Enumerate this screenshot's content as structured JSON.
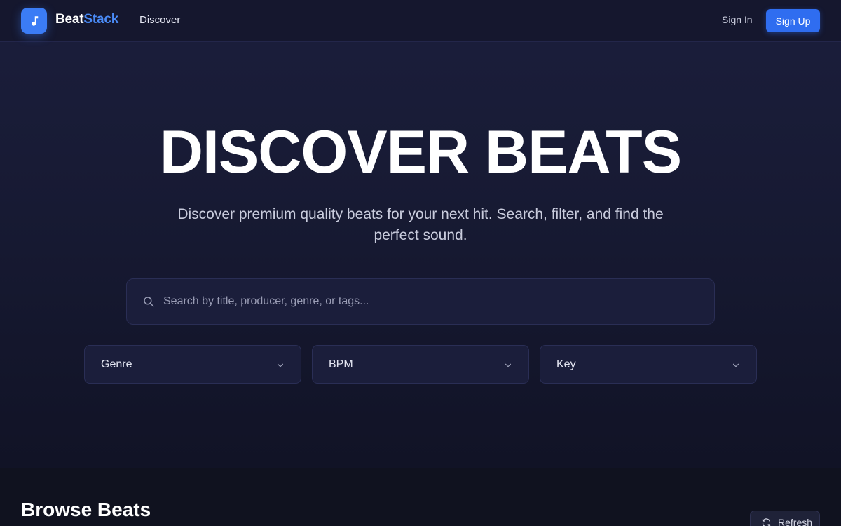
{
  "nav": {
    "brand_part1": "Beat",
    "brand_part2": "Stack",
    "logo_icon": "music-note-icon",
    "discover_label": "Discover",
    "signin_label": "Sign In",
    "signup_label": "Sign Up"
  },
  "hero": {
    "title": "DISCOVER BEATS",
    "subtitle": "Discover premium quality beats for your next hit. Search, filter, and find the perfect sound."
  },
  "search": {
    "placeholder": "Search by title, producer, genre, or tags...",
    "value": "",
    "icon": "search-icon"
  },
  "filters": [
    {
      "label": "Genre",
      "icon": "chevron-down-icon"
    },
    {
      "label": "BPM",
      "icon": "chevron-down-icon"
    },
    {
      "label": "Key",
      "icon": "chevron-down-icon"
    }
  ],
  "browse": {
    "title": "Browse Beats",
    "refresh_label": "Refresh",
    "refresh_icon": "refresh-icon"
  },
  "colors": {
    "accent": "#3b7cf5",
    "brand_highlight": "#4a8bf7",
    "background": "#171a33",
    "panel": "#1b1e3b"
  }
}
